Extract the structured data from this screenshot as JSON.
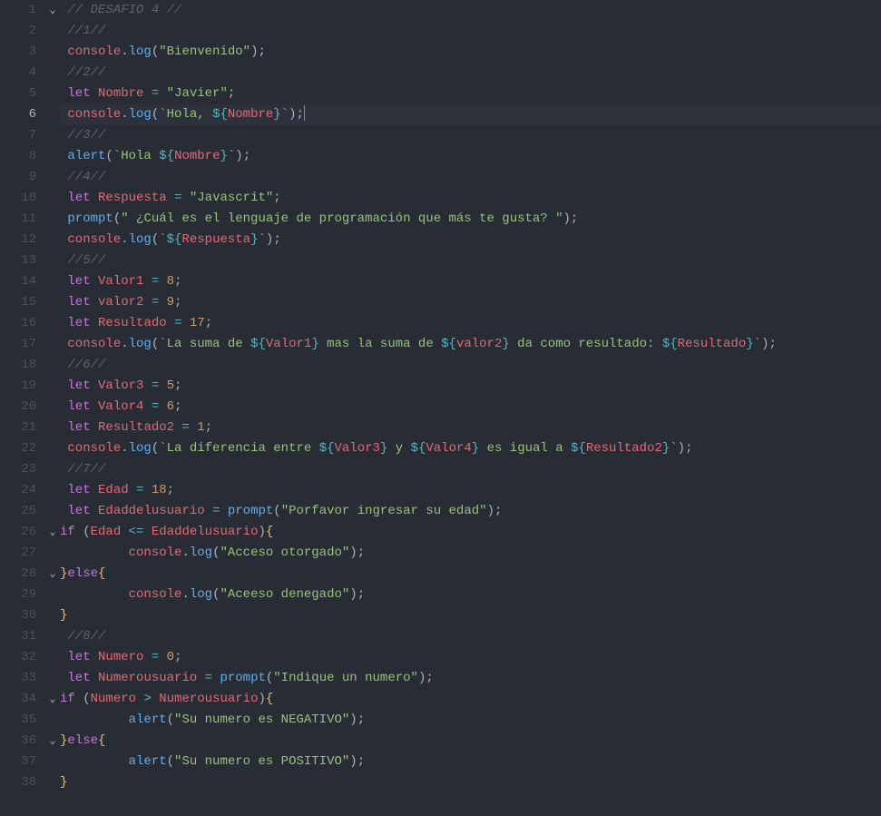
{
  "activeLine": 6,
  "foldLines": [
    1,
    26,
    28,
    34,
    36
  ],
  "lines": [
    {
      "n": 1,
      "tokens": [
        [
          "comment",
          "// DESAFIO 4 //"
        ]
      ]
    },
    {
      "n": 2,
      "tokens": [
        [
          "comment",
          "//1//"
        ]
      ]
    },
    {
      "n": 3,
      "tokens": [
        [
          "variable",
          "console"
        ],
        [
          "punct",
          "."
        ],
        [
          "func",
          "log"
        ],
        [
          "paren",
          "("
        ],
        [
          "string",
          "\"Bienvenido\""
        ],
        [
          "paren",
          ")"
        ],
        [
          "punct",
          ";"
        ]
      ]
    },
    {
      "n": 4,
      "tokens": [
        [
          "comment",
          "//2//"
        ]
      ]
    },
    {
      "n": 5,
      "tokens": [
        [
          "keyword",
          "let"
        ],
        [
          "plain",
          " "
        ],
        [
          "variable",
          "Nombre"
        ],
        [
          "plain",
          " "
        ],
        [
          "operator",
          "="
        ],
        [
          "plain",
          " "
        ],
        [
          "string",
          "\"Javier\""
        ],
        [
          "punct",
          ";"
        ]
      ]
    },
    {
      "n": 6,
      "tokens": [
        [
          "variable",
          "console"
        ],
        [
          "punct",
          "."
        ],
        [
          "func",
          "log"
        ],
        [
          "paren",
          "("
        ],
        [
          "template",
          "`Hola, "
        ],
        [
          "interp-brace",
          "${"
        ],
        [
          "interp",
          "Nombre"
        ],
        [
          "interp-brace",
          "}"
        ],
        [
          "template",
          "`"
        ],
        [
          "paren",
          ")"
        ],
        [
          "punct",
          ";"
        ],
        [
          "cursor",
          ""
        ]
      ]
    },
    {
      "n": 7,
      "tokens": [
        [
          "comment",
          "//3//"
        ]
      ]
    },
    {
      "n": 8,
      "tokens": [
        [
          "func",
          "alert"
        ],
        [
          "paren",
          "("
        ],
        [
          "template",
          "`Hola "
        ],
        [
          "interp-brace",
          "${"
        ],
        [
          "interp",
          "Nombre"
        ],
        [
          "interp-brace",
          "}"
        ],
        [
          "template",
          "`"
        ],
        [
          "paren",
          ")"
        ],
        [
          "punct",
          ";"
        ]
      ]
    },
    {
      "n": 9,
      "tokens": [
        [
          "comment",
          "//4//"
        ]
      ]
    },
    {
      "n": 10,
      "tokens": [
        [
          "keyword",
          "let"
        ],
        [
          "plain",
          " "
        ],
        [
          "variable",
          "Respuesta"
        ],
        [
          "plain",
          " "
        ],
        [
          "operator",
          "="
        ],
        [
          "plain",
          " "
        ],
        [
          "string",
          "\"Javascrit\""
        ],
        [
          "punct",
          ";"
        ]
      ]
    },
    {
      "n": 11,
      "tokens": [
        [
          "func",
          "prompt"
        ],
        [
          "paren",
          "("
        ],
        [
          "string",
          "\" ¿Cuál es el lenguaje de programación que más te gusta? \""
        ],
        [
          "paren",
          ")"
        ],
        [
          "punct",
          ";"
        ]
      ]
    },
    {
      "n": 12,
      "tokens": [
        [
          "variable",
          "console"
        ],
        [
          "punct",
          "."
        ],
        [
          "func",
          "log"
        ],
        [
          "paren",
          "("
        ],
        [
          "template",
          "`"
        ],
        [
          "interp-brace",
          "${"
        ],
        [
          "interp",
          "Respuesta"
        ],
        [
          "interp-brace",
          "}"
        ],
        [
          "template",
          "`"
        ],
        [
          "paren",
          ")"
        ],
        [
          "punct",
          ";"
        ]
      ]
    },
    {
      "n": 13,
      "tokens": [
        [
          "comment",
          "//5//"
        ]
      ]
    },
    {
      "n": 14,
      "tokens": [
        [
          "keyword",
          "let"
        ],
        [
          "plain",
          " "
        ],
        [
          "variable",
          "Valor1"
        ],
        [
          "plain",
          " "
        ],
        [
          "operator",
          "="
        ],
        [
          "plain",
          " "
        ],
        [
          "number",
          "8"
        ],
        [
          "punct",
          ";"
        ]
      ]
    },
    {
      "n": 15,
      "tokens": [
        [
          "keyword",
          "let"
        ],
        [
          "plain",
          " "
        ],
        [
          "variable",
          "valor2"
        ],
        [
          "plain",
          " "
        ],
        [
          "operator",
          "="
        ],
        [
          "plain",
          " "
        ],
        [
          "number",
          "9"
        ],
        [
          "punct",
          ";"
        ]
      ]
    },
    {
      "n": 16,
      "tokens": [
        [
          "keyword",
          "let"
        ],
        [
          "plain",
          " "
        ],
        [
          "variable",
          "Resultado"
        ],
        [
          "plain",
          " "
        ],
        [
          "operator",
          "="
        ],
        [
          "plain",
          " "
        ],
        [
          "number",
          "17"
        ],
        [
          "punct",
          ";"
        ]
      ]
    },
    {
      "n": 17,
      "tokens": [
        [
          "variable",
          "console"
        ],
        [
          "punct",
          "."
        ],
        [
          "func",
          "log"
        ],
        [
          "paren",
          "("
        ],
        [
          "template",
          "`La suma de "
        ],
        [
          "interp-brace",
          "${"
        ],
        [
          "interp",
          "Valor1"
        ],
        [
          "interp-brace",
          "}"
        ],
        [
          "template",
          " mas la suma de "
        ],
        [
          "interp-brace",
          "${"
        ],
        [
          "interp",
          "valor2"
        ],
        [
          "interp-brace",
          "}"
        ],
        [
          "template",
          " da como resultado: "
        ],
        [
          "interp-brace",
          "${"
        ],
        [
          "interp",
          "Resultado"
        ],
        [
          "interp-brace",
          "}"
        ],
        [
          "template",
          "`"
        ],
        [
          "paren",
          ")"
        ],
        [
          "punct",
          ";"
        ]
      ]
    },
    {
      "n": 18,
      "tokens": [
        [
          "comment",
          "//6//"
        ]
      ]
    },
    {
      "n": 19,
      "tokens": [
        [
          "keyword",
          "let"
        ],
        [
          "plain",
          " "
        ],
        [
          "variable",
          "Valor3"
        ],
        [
          "plain",
          " "
        ],
        [
          "operator",
          "="
        ],
        [
          "plain",
          " "
        ],
        [
          "number",
          "5"
        ],
        [
          "punct",
          ";"
        ]
      ]
    },
    {
      "n": 20,
      "tokens": [
        [
          "keyword",
          "let"
        ],
        [
          "plain",
          " "
        ],
        [
          "variable",
          "Valor4"
        ],
        [
          "plain",
          " "
        ],
        [
          "operator",
          "="
        ],
        [
          "plain",
          " "
        ],
        [
          "number",
          "6"
        ],
        [
          "punct",
          ";"
        ]
      ]
    },
    {
      "n": 21,
      "tokens": [
        [
          "keyword",
          "let"
        ],
        [
          "plain",
          " "
        ],
        [
          "variable",
          "Resultado2"
        ],
        [
          "plain",
          " "
        ],
        [
          "operator",
          "="
        ],
        [
          "plain",
          " "
        ],
        [
          "number",
          "1"
        ],
        [
          "punct",
          ";"
        ]
      ]
    },
    {
      "n": 22,
      "tokens": [
        [
          "variable",
          "console"
        ],
        [
          "punct",
          "."
        ],
        [
          "func",
          "log"
        ],
        [
          "paren",
          "("
        ],
        [
          "template",
          "`La diferencia entre "
        ],
        [
          "interp-brace",
          "${"
        ],
        [
          "interp",
          "Valor3"
        ],
        [
          "interp-brace",
          "}"
        ],
        [
          "template",
          " y "
        ],
        [
          "interp-brace",
          "${"
        ],
        [
          "interp",
          "Valor4"
        ],
        [
          "interp-brace",
          "}"
        ],
        [
          "template",
          " es igual a "
        ],
        [
          "interp-brace",
          "${"
        ],
        [
          "interp",
          "Resultado2"
        ],
        [
          "interp-brace",
          "}"
        ],
        [
          "template",
          "`"
        ],
        [
          "paren",
          ")"
        ],
        [
          "punct",
          ";"
        ]
      ]
    },
    {
      "n": 23,
      "tokens": [
        [
          "comment",
          "//7//"
        ]
      ]
    },
    {
      "n": 24,
      "tokens": [
        [
          "keyword",
          "let"
        ],
        [
          "plain",
          " "
        ],
        [
          "variable",
          "Edad"
        ],
        [
          "plain",
          " "
        ],
        [
          "operator",
          "="
        ],
        [
          "plain",
          " "
        ],
        [
          "number",
          "18"
        ],
        [
          "punct",
          ";"
        ]
      ]
    },
    {
      "n": 25,
      "tokens": [
        [
          "keyword",
          "let"
        ],
        [
          "plain",
          " "
        ],
        [
          "variable",
          "Edaddelusuario"
        ],
        [
          "plain",
          " "
        ],
        [
          "operator",
          "="
        ],
        [
          "plain",
          " "
        ],
        [
          "func",
          "prompt"
        ],
        [
          "paren",
          "("
        ],
        [
          "string",
          "\"Porfavor ingresar su edad\""
        ],
        [
          "paren",
          ")"
        ],
        [
          "punct",
          ";"
        ]
      ]
    },
    {
      "n": 26,
      "noindent": true,
      "tokens": [
        [
          "keyword",
          "if"
        ],
        [
          "plain",
          " "
        ],
        [
          "paren",
          "("
        ],
        [
          "variable",
          "Edad"
        ],
        [
          "plain",
          " "
        ],
        [
          "operator",
          "<="
        ],
        [
          "plain",
          " "
        ],
        [
          "variable",
          "Edaddelusuario"
        ],
        [
          "paren",
          ")"
        ],
        [
          "brace-y",
          "{"
        ]
      ]
    },
    {
      "n": 27,
      "indent": 2,
      "tokens": [
        [
          "variable",
          "console"
        ],
        [
          "punct",
          "."
        ],
        [
          "func",
          "log"
        ],
        [
          "paren",
          "("
        ],
        [
          "string",
          "\"Acceso otorgado\""
        ],
        [
          "paren",
          ")"
        ],
        [
          "punct",
          ";"
        ]
      ]
    },
    {
      "n": 28,
      "noindent": true,
      "tokens": [
        [
          "brace-y",
          "}"
        ],
        [
          "keyword",
          "else"
        ],
        [
          "brace-y",
          "{"
        ]
      ]
    },
    {
      "n": 29,
      "indent": 2,
      "tokens": [
        [
          "variable",
          "console"
        ],
        [
          "punct",
          "."
        ],
        [
          "func",
          "log"
        ],
        [
          "paren",
          "("
        ],
        [
          "string",
          "\"Aceeso denegado\""
        ],
        [
          "paren",
          ")"
        ],
        [
          "punct",
          ";"
        ]
      ]
    },
    {
      "n": 30,
      "noindent": true,
      "tokens": [
        [
          "brace-y",
          "}"
        ]
      ]
    },
    {
      "n": 31,
      "tokens": [
        [
          "comment",
          "//8//"
        ]
      ]
    },
    {
      "n": 32,
      "tokens": [
        [
          "keyword",
          "let"
        ],
        [
          "plain",
          " "
        ],
        [
          "variable",
          "Numero"
        ],
        [
          "plain",
          " "
        ],
        [
          "operator",
          "="
        ],
        [
          "plain",
          " "
        ],
        [
          "number",
          "0"
        ],
        [
          "punct",
          ";"
        ]
      ]
    },
    {
      "n": 33,
      "tokens": [
        [
          "keyword",
          "let"
        ],
        [
          "plain",
          " "
        ],
        [
          "variable",
          "Numerousuario"
        ],
        [
          "plain",
          " "
        ],
        [
          "operator",
          "="
        ],
        [
          "plain",
          " "
        ],
        [
          "func",
          "prompt"
        ],
        [
          "paren",
          "("
        ],
        [
          "string",
          "\"Indique un numero\""
        ],
        [
          "paren",
          ")"
        ],
        [
          "punct",
          ";"
        ]
      ]
    },
    {
      "n": 34,
      "noindent": true,
      "tokens": [
        [
          "keyword",
          "if"
        ],
        [
          "plain",
          " "
        ],
        [
          "paren",
          "("
        ],
        [
          "variable",
          "Numero"
        ],
        [
          "plain",
          " "
        ],
        [
          "operator",
          ">"
        ],
        [
          "plain",
          " "
        ],
        [
          "variable",
          "Numerousuario"
        ],
        [
          "paren",
          ")"
        ],
        [
          "brace-y",
          "{"
        ]
      ]
    },
    {
      "n": 35,
      "indent": 2,
      "tokens": [
        [
          "func",
          "alert"
        ],
        [
          "paren",
          "("
        ],
        [
          "string",
          "\"Su numero es NEGATIVO\""
        ],
        [
          "paren",
          ")"
        ],
        [
          "punct",
          ";"
        ]
      ]
    },
    {
      "n": 36,
      "noindent": true,
      "tokens": [
        [
          "brace-y",
          "}"
        ],
        [
          "keyword",
          "else"
        ],
        [
          "brace-y",
          "{"
        ]
      ]
    },
    {
      "n": 37,
      "indent": 2,
      "tokens": [
        [
          "func",
          "alert"
        ],
        [
          "paren",
          "("
        ],
        [
          "string",
          "\"Su numero es POSITIVO\""
        ],
        [
          "paren",
          ")"
        ],
        [
          "punct",
          ";"
        ]
      ]
    },
    {
      "n": 38,
      "noindent": true,
      "tokens": [
        [
          "brace-y",
          "}"
        ]
      ]
    }
  ]
}
